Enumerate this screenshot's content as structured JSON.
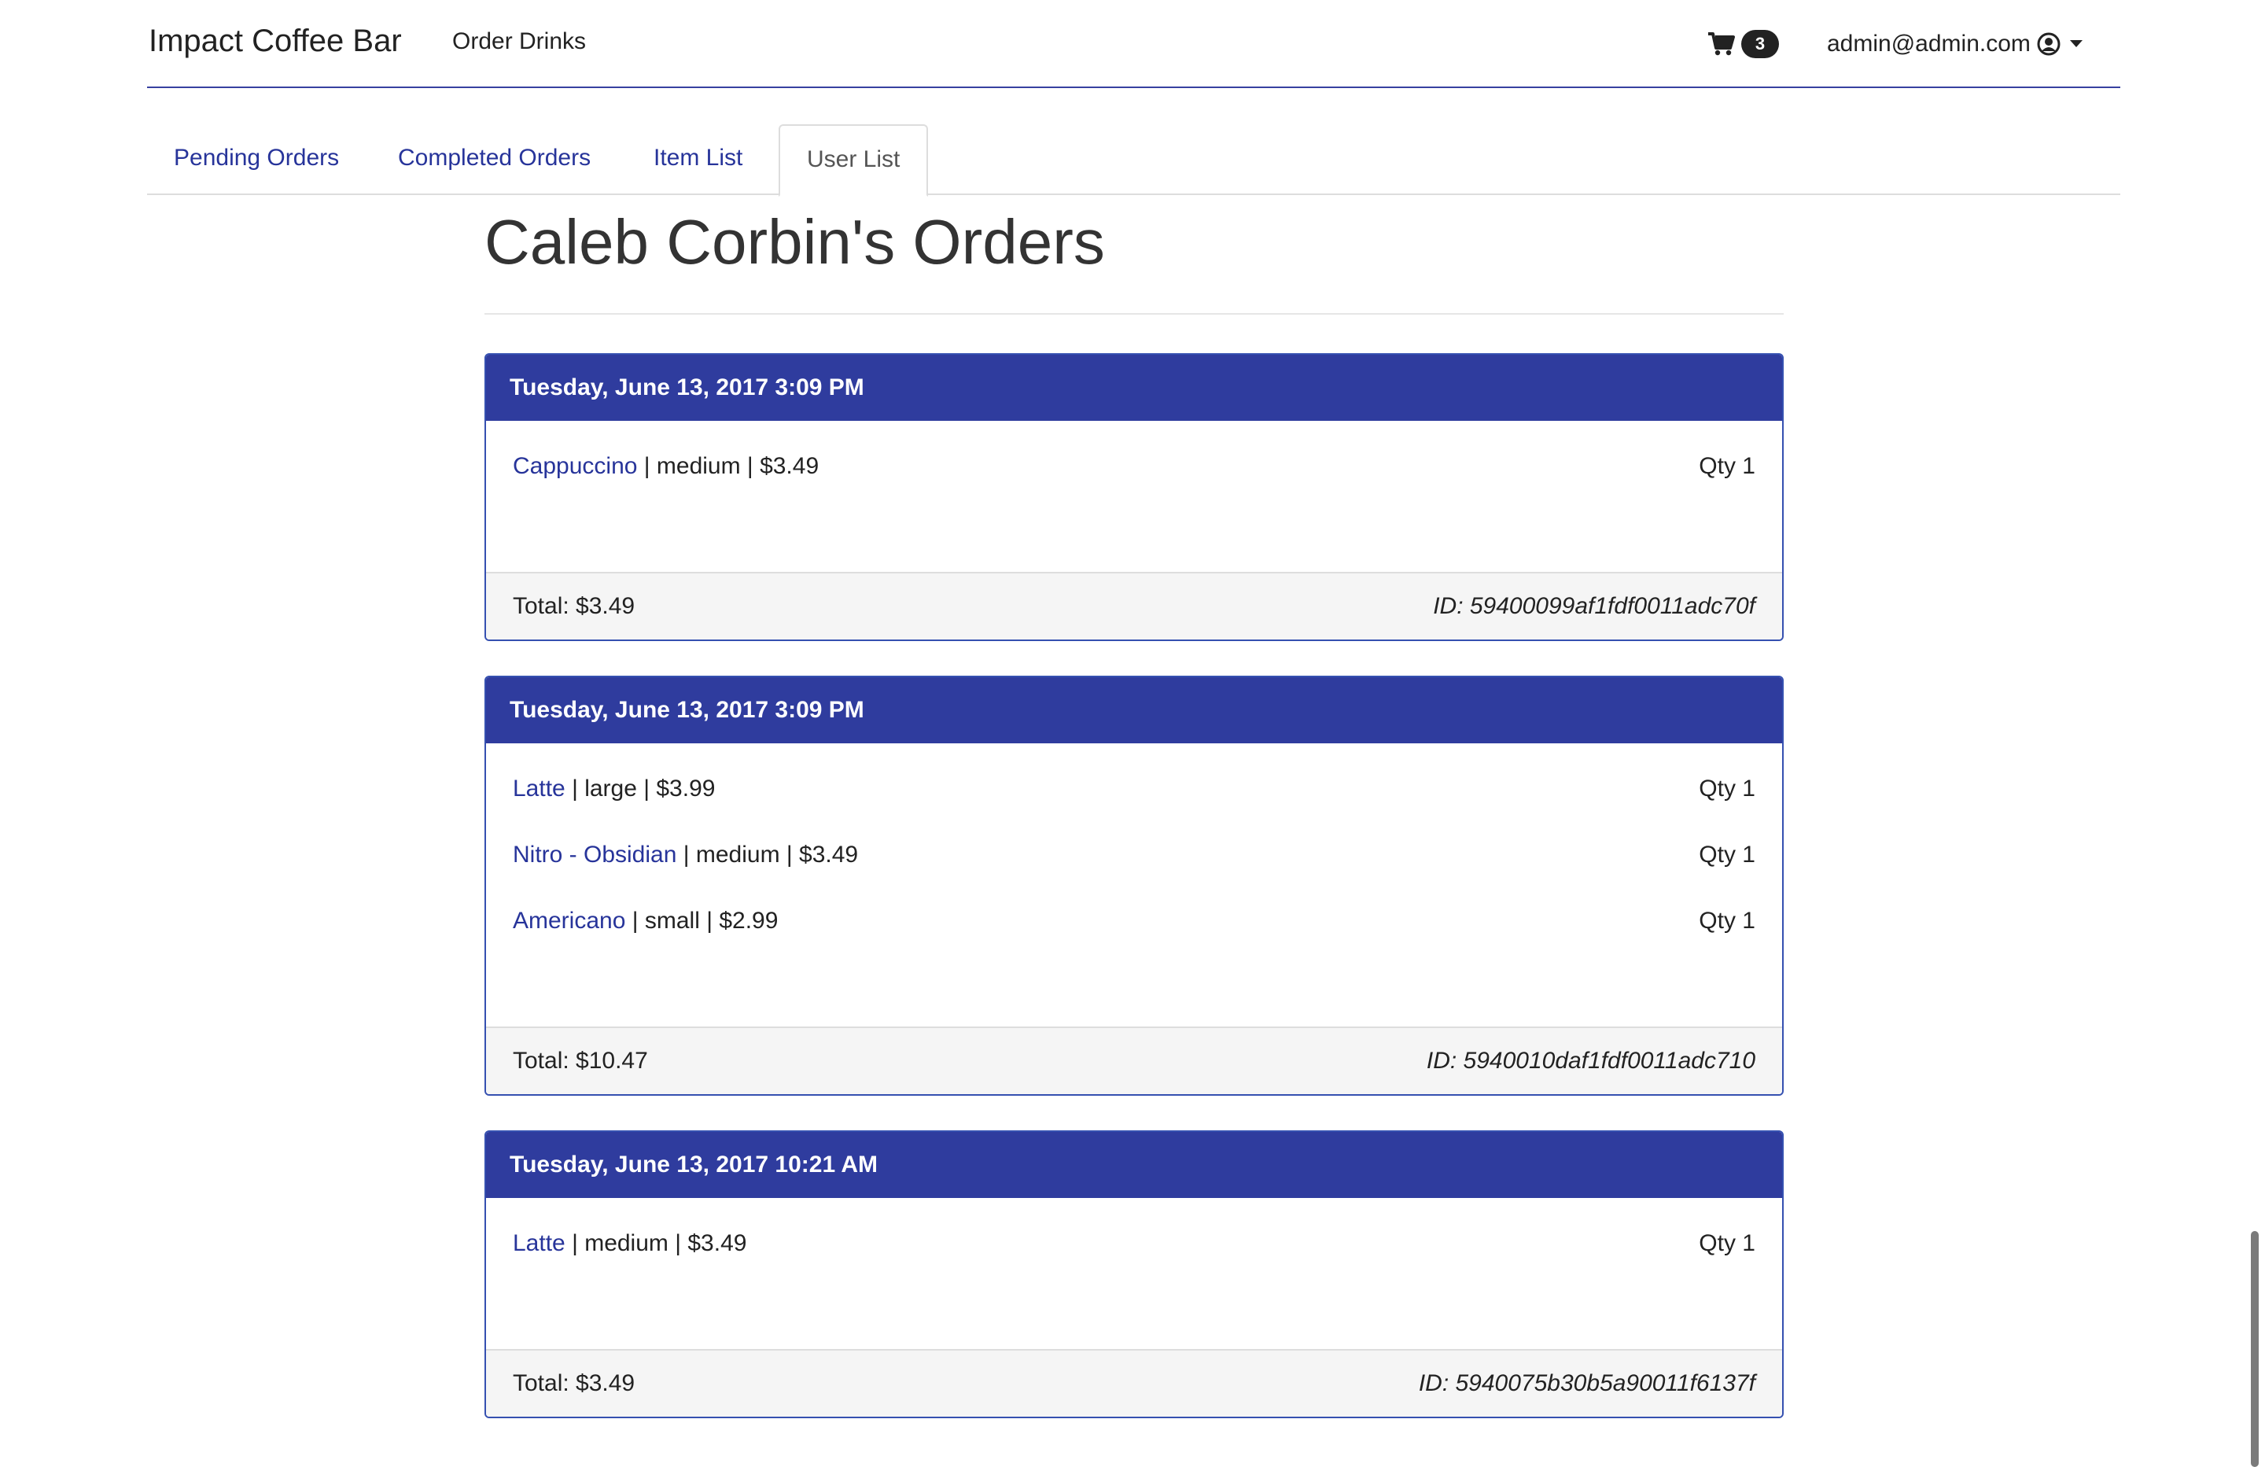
{
  "navbar": {
    "brand": "Impact Coffee Bar",
    "order_link": "Order Drinks",
    "cart_count": "3",
    "user_email": "admin@admin.com"
  },
  "tabs": [
    {
      "label": "Pending Orders",
      "active": false
    },
    {
      "label": "Completed Orders",
      "active": false
    },
    {
      "label": "Item List",
      "active": false
    },
    {
      "label": "User List",
      "active": true
    }
  ],
  "page_title": "Caleb Corbin's Orders",
  "orders": [
    {
      "date": "Tuesday, June 13, 2017 3:09 PM",
      "items": [
        {
          "name": "Cappuccino",
          "details": " | medium | $3.49",
          "qty": "Qty 1"
        }
      ],
      "total": "Total: $3.49",
      "id": "ID: 59400099af1fdf0011adc70f"
    },
    {
      "date": "Tuesday, June 13, 2017 3:09 PM",
      "items": [
        {
          "name": "Latte",
          "details": " | large | $3.99",
          "qty": "Qty 1"
        },
        {
          "name": "Nitro - Obsidian",
          "details": " | medium | $3.49",
          "qty": "Qty 1"
        },
        {
          "name": "Americano",
          "details": " | small | $2.99",
          "qty": "Qty 1"
        }
      ],
      "total": "Total: $10.47",
      "id": "ID: 5940010daf1fdf0011adc710"
    },
    {
      "date": "Tuesday, June 13, 2017 10:21 AM",
      "items": [
        {
          "name": "Latte",
          "details": " | medium | $3.49",
          "qty": "Qty 1"
        }
      ],
      "total": "Total: $3.49",
      "id": "ID: 5940075b30b5a90011f6137f"
    }
  ],
  "icons": {
    "cart": "shopping-cart-icon",
    "user": "user-circle-icon",
    "caret": "caret-down-icon"
  },
  "colors": {
    "primary": "#2f3c9e",
    "link": "#27349a",
    "panel_border": "#3550b0"
  }
}
